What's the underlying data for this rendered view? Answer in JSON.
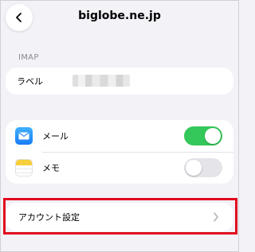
{
  "header": {
    "title": "biglobe.ne.jp",
    "back_icon": "chevron-left-icon"
  },
  "imap_section": {
    "header": "IMAP",
    "label_row": {
      "label": "ラベル",
      "value": ""
    }
  },
  "toggles": [
    {
      "label": "メール",
      "icon": "mail-icon",
      "enabled": true
    },
    {
      "label": "メモ",
      "icon": "notes-icon",
      "enabled": false
    }
  ],
  "account": {
    "label": "アカウント設定",
    "chevron_icon": "chevron-right-icon"
  },
  "colors": {
    "switch_on": "#34c759",
    "switch_off": "#e4e4e9",
    "highlight": "#e10a1e",
    "background": "#f2f2f7"
  }
}
